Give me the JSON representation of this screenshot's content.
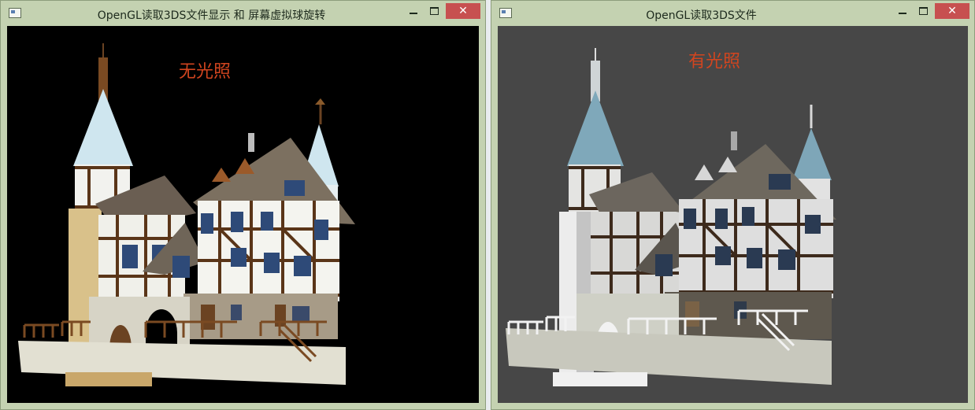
{
  "windows": {
    "left": {
      "title": "OpenGL读取3DS文件显示 和 屏幕虚拟球旋转",
      "overlay_label": "无光照",
      "label_color": "#d2451f",
      "background": "#000000"
    },
    "right": {
      "title": "OpenGL读取3DS文件",
      "overlay_label": "有光照",
      "label_color": "#d2451f",
      "background": "#474747"
    }
  },
  "controls": {
    "minimize_icon": "minimize-icon",
    "maximize_icon": "maximize-icon",
    "close_icon": "close-icon",
    "close_label": "✕",
    "close_color": "#c75050"
  },
  "frame_color": "#c4d2b1"
}
